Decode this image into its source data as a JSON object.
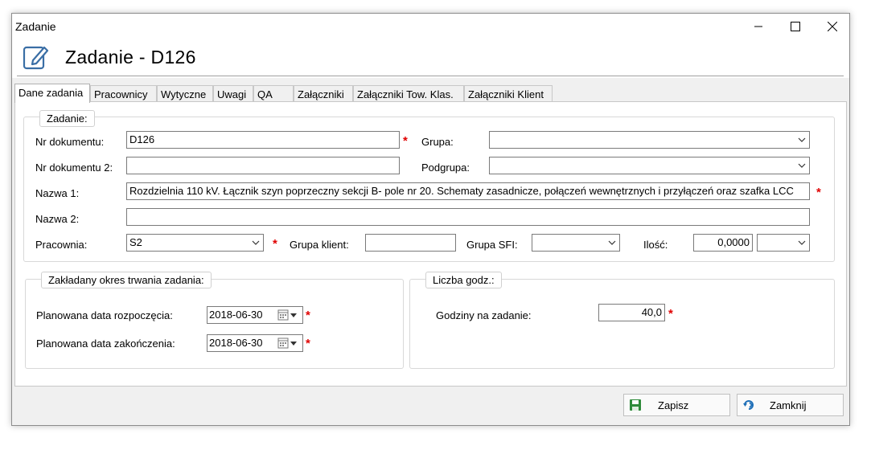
{
  "window": {
    "title": "Zadanie"
  },
  "header": {
    "title": "Zadanie - D126",
    "icon": "edit-icon"
  },
  "tabs": [
    {
      "label": "Dane zadania",
      "active": true
    },
    {
      "label": "Pracownicy"
    },
    {
      "label": "Wytyczne"
    },
    {
      "label": "Uwagi"
    },
    {
      "label": "QA"
    },
    {
      "label": "Załączniki"
    },
    {
      "label": "Załączniki Tow. Klas."
    },
    {
      "label": "Załączniki Klient"
    }
  ],
  "zadanie_group": {
    "legend": "Zadanie:",
    "nr_dokumentu": {
      "label": "Nr dokumentu:",
      "value": "D126"
    },
    "nr_dokumentu2": {
      "label": "Nr dokumentu 2:",
      "value": ""
    },
    "nazwa1": {
      "label": "Nazwa 1:",
      "value": "Rozdzielnia 110 kV. Łącznik szyn poprzeczny sekcji B- pole nr 20.  Schematy zasadnicze, połączeń wewnętrznych i przyłączeń oraz szafka LCC"
    },
    "nazwa2": {
      "label": "Nazwa 2:",
      "value": ""
    },
    "grupa": {
      "label": "Grupa:",
      "value": ""
    },
    "podgrupa": {
      "label": "Podgrupa:",
      "value": ""
    },
    "pracownia": {
      "label": "Pracownia:",
      "value": "S2"
    },
    "grupa_klient": {
      "label": "Grupa klient:",
      "value": ""
    },
    "grupa_sfi": {
      "label": "Grupa SFI:",
      "value": ""
    },
    "ilosc": {
      "label": "Ilość:",
      "value": "0,0000",
      "unit": ""
    },
    "required_mark": "*"
  },
  "okres_group": {
    "legend": "Zakładany okres trwania zadania:",
    "start": {
      "label": "Planowana data rozpoczęcia:",
      "value": "2018-06-30"
    },
    "end": {
      "label": "Planowana data zakończenia:",
      "value": "2018-06-30"
    }
  },
  "godz_group": {
    "legend": "Liczba godz.:",
    "hours": {
      "label": "Godziny na zadanie:",
      "value": "40,0"
    }
  },
  "footer": {
    "save_label": "Zapisz",
    "close_label": "Zamknij"
  },
  "colors": {
    "required": "#e00000",
    "save_icon": "#2e8b3a",
    "close_icon": "#1e6fb8"
  }
}
